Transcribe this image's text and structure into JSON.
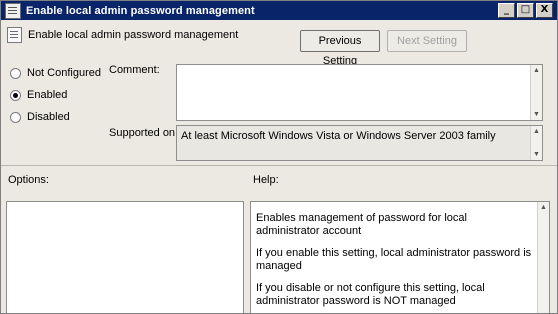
{
  "window": {
    "title": "Enable local admin password management",
    "minimize": "_",
    "maximize": "□",
    "close": "X"
  },
  "header": {
    "policy_name": "Enable local admin password management",
    "previous_button": "Previous Setting",
    "next_button": "Next Setting"
  },
  "state": {
    "not_configured": "Not Configured",
    "enabled": "Enabled",
    "disabled": "Disabled",
    "selected": "Enabled"
  },
  "comment": {
    "label": "Comment:",
    "value": ""
  },
  "supported": {
    "label": "Supported on:",
    "value": "At least Microsoft Windows Vista or Windows Server 2003 family"
  },
  "options": {
    "label": "Options:"
  },
  "help": {
    "label": "Help:",
    "paragraphs": [
      "Enables management of password for local administrator account",
      "If you enable this setting, local administrator password is managed",
      "If you disable or not configure this setting, local administrator password is NOT managed"
    ]
  }
}
